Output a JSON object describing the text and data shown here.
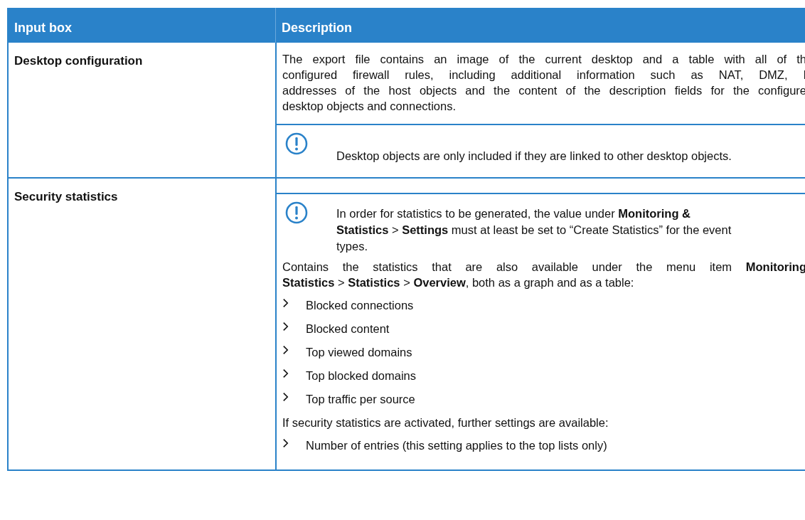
{
  "table": {
    "columns": [
      "Input box",
      "Description"
    ],
    "rows": [
      {
        "label": "Desktop configuration",
        "blocks": [
          {
            "kind": "para",
            "lines": [
              "The export file contains an image of the current desktop and a table with all of th",
              "configured firewall rules, including additional information such as NAT, DMZ, I",
              "addresses of the host objects and the content of the description fields for the configure",
              "desktop objects and connections."
            ]
          },
          {
            "kind": "note",
            "lines": [
              "Desktop objects are only included if they are linked to other desktop objects."
            ]
          }
        ]
      },
      {
        "label": "Security statistics",
        "blocks": [
          {
            "kind": "note",
            "lines": [
              "In order for statistics to be generated, the value under **Monitoring &**",
              "**Statistics** > **Settings** must at least be set to “Create Statistics” for the event",
              "types."
            ]
          },
          {
            "kind": "para",
            "lines": [
              "Contains the statistics that are also available under the menu item **Monitoring**",
              "**Statistics** > **Statistics** > **Overview**, both as a graph and as a table:"
            ]
          },
          {
            "kind": "list",
            "items": [
              "Blocked connections",
              "Blocked content",
              "Top viewed domains",
              "Top blocked domains",
              "Top traffic per source"
            ]
          },
          {
            "kind": "para",
            "lines": [
              "If security statistics are activated, further settings are available:"
            ]
          },
          {
            "kind": "list",
            "items": [
              "Number of entries (this setting applies to the top lists only)"
            ]
          }
        ]
      }
    ]
  }
}
